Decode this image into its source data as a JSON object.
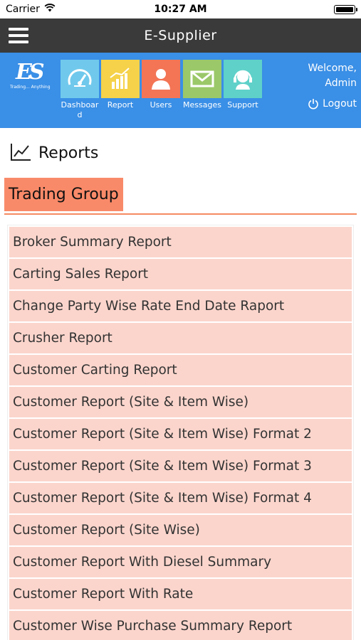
{
  "status_bar": {
    "carrier": "Carrier",
    "time": "10:27 AM"
  },
  "app": {
    "title": "E-Supplier"
  },
  "logo": {
    "mark": "ES",
    "tagline": "Trading... Anything"
  },
  "nav": {
    "tiles": [
      {
        "label": "Dashboar d",
        "color": "#70c9ec",
        "icon": "speedometer-icon"
      },
      {
        "label": "Report",
        "color": "#f5d24a",
        "icon": "bar-chart-icon"
      },
      {
        "label": "Users",
        "color": "#f37556",
        "icon": "user-icon"
      },
      {
        "label": "Messages",
        "color": "#9bc869",
        "icon": "envelope-icon"
      },
      {
        "label": "Support",
        "color": "#5fd1c9",
        "icon": "headset-icon"
      }
    ],
    "welcome_line1": "Welcome,",
    "welcome_line2": "Admin",
    "logout_label": "Logout"
  },
  "page": {
    "title": "Reports"
  },
  "group": {
    "title": "Trading Group",
    "accent": "#f98a69"
  },
  "reports": [
    "Broker Summary Report",
    "Carting Sales Report",
    "Change Party Wise Rate End Date Raport",
    "Crusher Report",
    "Customer Carting Report",
    "Customer Report (Site & Item Wise)",
    "Customer Report (Site & Item Wise) Format 2",
    "Customer Report (Site & Item Wise) Format 3",
    "Customer Report (Site & Item Wise) Format 4",
    "Customer Report (Site Wise)",
    "Customer Report With Diesel Summary",
    "Customer Report With Rate",
    "Customer Wise Purchase Summary Report"
  ],
  "colors": {
    "topbar": "#3a3a3a",
    "navband": "#3a8fe6",
    "list_item": "#fbd5cc"
  }
}
